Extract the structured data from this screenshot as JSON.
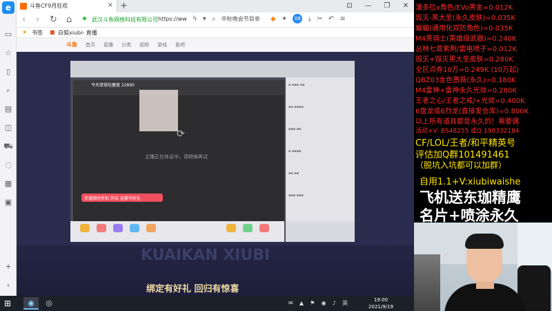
{
  "browser": {
    "tab_title": "斗鱼CF9月狂欢",
    "tab_close": "×",
    "new_tab": "+",
    "window_controls": [
      "⊡",
      "—",
      "❐",
      "✕"
    ],
    "nav": {
      "back": "‹",
      "forward": "›",
      "refresh": "↻",
      "home": "⌂"
    },
    "url_site": "武汉斗鱼网络科技有限公司",
    "url_text": "https://ww",
    "search_hint": "中秋晚会节目单",
    "ext_badge": "06",
    "bookmarks": [
      "书签",
      "白狐xiubi- 直播"
    ]
  },
  "sidebar": {
    "icons": [
      "browser-logo-icon",
      "tab-list-icon",
      "star-icon",
      "book-icon",
      "search-icon",
      "news-icon",
      "box-icon",
      "cart-icon",
      "chat-icon",
      "calendar-icon",
      "video-icon",
      "add-icon",
      "collapse-icon"
    ],
    "logo": "e"
  },
  "page": {
    "site_logo": "斗鱼",
    "nav_items": [
      "首页",
      "直播",
      "分类",
      "视频",
      "游戏",
      "鱼吧"
    ],
    "player_title": "今天双倍哇塞度 22890",
    "player_status": "主播正在休息中，请稍候再试",
    "ad_text": "充值限时折扣 开启 送豪华好礼",
    "promo_text": "绑定有好礼 回归有惊喜",
    "promo_bg_text": "KUAIKAN XIUBI"
  },
  "taskbar": {
    "start_glyph": "⊞",
    "tray_items": [
      "✉",
      "▲",
      "⚑",
      "◉",
      "♪",
      "英"
    ],
    "time": "19:00",
    "date": "2021/9/19"
  },
  "overlay": {
    "price_lines": [
      "潘多拉x角色/EVo黑金=0.012K",
      "毁灭-黑大圣(永久皮肤)=0.035K",
      "蝙蝠(通用化双防角色)=0.035K",
      "M4黑骑士(英雄级武器)=0.240K",
      "丛林七首紫荆/雷电喷子=0.012K",
      "毁灭+毁灭黑大圣皮肤=0.280K",
      "全区点券10万=0.249K (10万起)",
      "QBZ03金色蔷薇(永久)=0.180K",
      "M4雷神+雷神永久光效=0.280K",
      "王者之心/王者之戒/+光效=0.400K",
      "6盘龙或6烈龙(直接发仓库)=0.800K",
      "以上所有道具都是永久的！需要偶",
      "活动+V: BS48255  或Q 198332184"
    ],
    "yellow_lines": [
      "CF/LOL/王者/和平精英号",
      "评估加Q群101491461",
      "（脱坑入坑都可以加群）"
    ],
    "contact": "自用1.1+V:xiubiwaishe",
    "big_lines": [
      "飞机送东珈精鹰",
      "名片+喷涂永久"
    ]
  }
}
